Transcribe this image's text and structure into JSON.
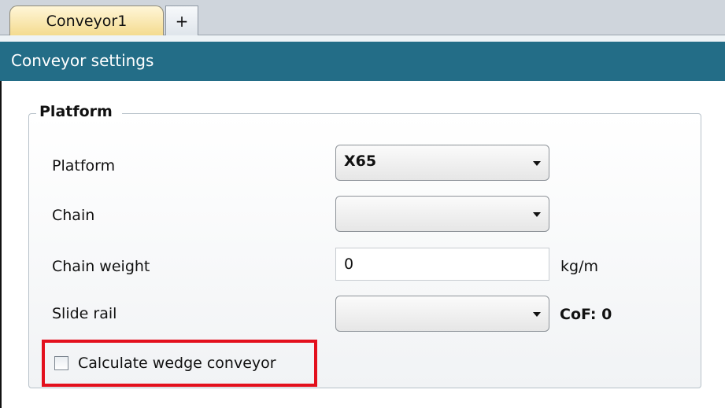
{
  "tabs": {
    "active_label": "Conveyor1",
    "add_label": "+"
  },
  "header": {
    "title": "Conveyor settings"
  },
  "platform_group": {
    "legend": "Platform",
    "fields": {
      "platform": {
        "label": "Platform",
        "value": "X65"
      },
      "chain": {
        "label": "Chain",
        "value": ""
      },
      "chain_weight": {
        "label": "Chain weight",
        "value": "0",
        "unit": "kg/m"
      },
      "slide_rail": {
        "label": "Slide rail",
        "value": "",
        "cof": "CoF: 0"
      }
    },
    "wedge_checkbox": {
      "label": "Calculate wedge conveyor",
      "checked": false
    }
  },
  "colors": {
    "header_bg": "#236d87",
    "tab_active_bg": "#f4db8f",
    "highlight_border": "#e3101d"
  }
}
